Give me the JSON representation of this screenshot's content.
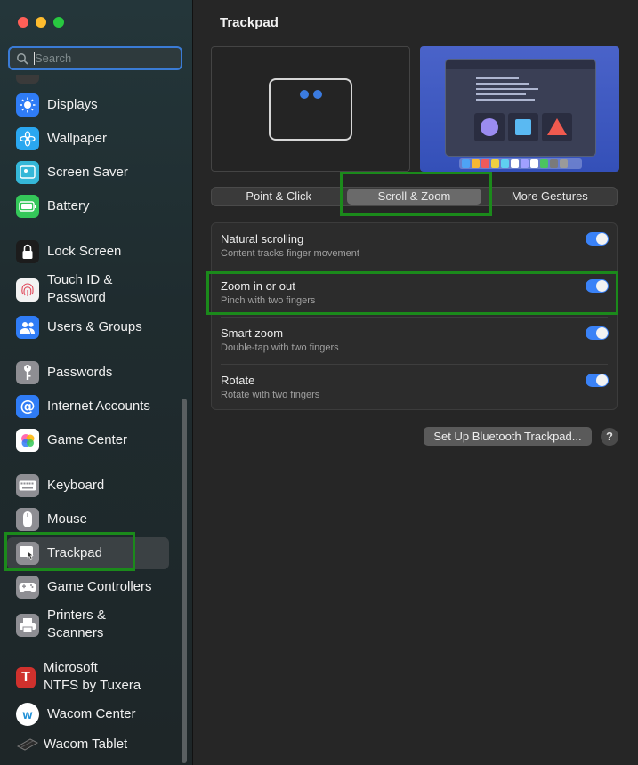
{
  "window": {
    "title": "Trackpad"
  },
  "search": {
    "placeholder": "Search"
  },
  "sidebar": {
    "items": [
      {
        "label": "Displays",
        "icon": "sun-icon",
        "color": "#2f7cf6"
      },
      {
        "label": "Wallpaper",
        "icon": "flower-icon",
        "color": "#2aa7f0"
      },
      {
        "label": "Screen Saver",
        "icon": "screensaver-icon",
        "color": "#35b7d8"
      },
      {
        "label": "Battery",
        "icon": "battery-icon",
        "color": "#34c759"
      },
      {
        "label": "Lock Screen",
        "icon": "lock-icon",
        "color": "#1c1c1c"
      },
      {
        "label": "Touch ID &\nPassword",
        "icon": "fingerprint-icon",
        "color": "#f2f2f2"
      },
      {
        "label": "Users & Groups",
        "icon": "users-icon",
        "color": "#2f7cf6"
      },
      {
        "label": "Passwords",
        "icon": "key-icon",
        "color": "#8e8e93"
      },
      {
        "label": "Internet Accounts",
        "icon": "at-icon",
        "color": "#2f7cf6"
      },
      {
        "label": "Game Center",
        "icon": "game-center-icon",
        "color": "#ffffff"
      },
      {
        "label": "Keyboard",
        "icon": "keyboard-icon",
        "color": "#8e8e93"
      },
      {
        "label": "Mouse",
        "icon": "mouse-icon",
        "color": "#8e8e93"
      },
      {
        "label": "Trackpad",
        "icon": "trackpad-icon",
        "color": "#8e8e93"
      },
      {
        "label": "Game Controllers",
        "icon": "gamepad-icon",
        "color": "#8e8e93"
      },
      {
        "label": "Printers &\nScanners",
        "icon": "printer-icon",
        "color": "#8e8e93"
      },
      {
        "label": "Microsoft\nNTFS by Tuxera",
        "icon": "tuxera-icon",
        "color": "#d0312d"
      },
      {
        "label": "Wacom Center",
        "icon": "wacom-icon",
        "color": "#ffffff"
      },
      {
        "label": "Wacom Tablet",
        "icon": "tablet-icon",
        "color": "#3a3a3a"
      }
    ],
    "selected": "Trackpad"
  },
  "tabs": [
    "Point & Click",
    "Scroll & Zoom",
    "More Gestures"
  ],
  "active_tab": "Scroll & Zoom",
  "settings": [
    {
      "title": "Natural scrolling",
      "subtitle": "Content tracks finger movement",
      "enabled": true
    },
    {
      "title": "Zoom in or out",
      "subtitle": "Pinch with two fingers",
      "enabled": true
    },
    {
      "title": "Smart zoom",
      "subtitle": "Double-tap with two fingers",
      "enabled": true
    },
    {
      "title": "Rotate",
      "subtitle": "Rotate with two fingers",
      "enabled": true
    }
  ],
  "buttons": {
    "bluetooth": "Set Up Bluetooth Trackpad...",
    "help": "?"
  },
  "colors": {
    "accent": "#3a82f7",
    "highlight": "#1b8a1b"
  }
}
